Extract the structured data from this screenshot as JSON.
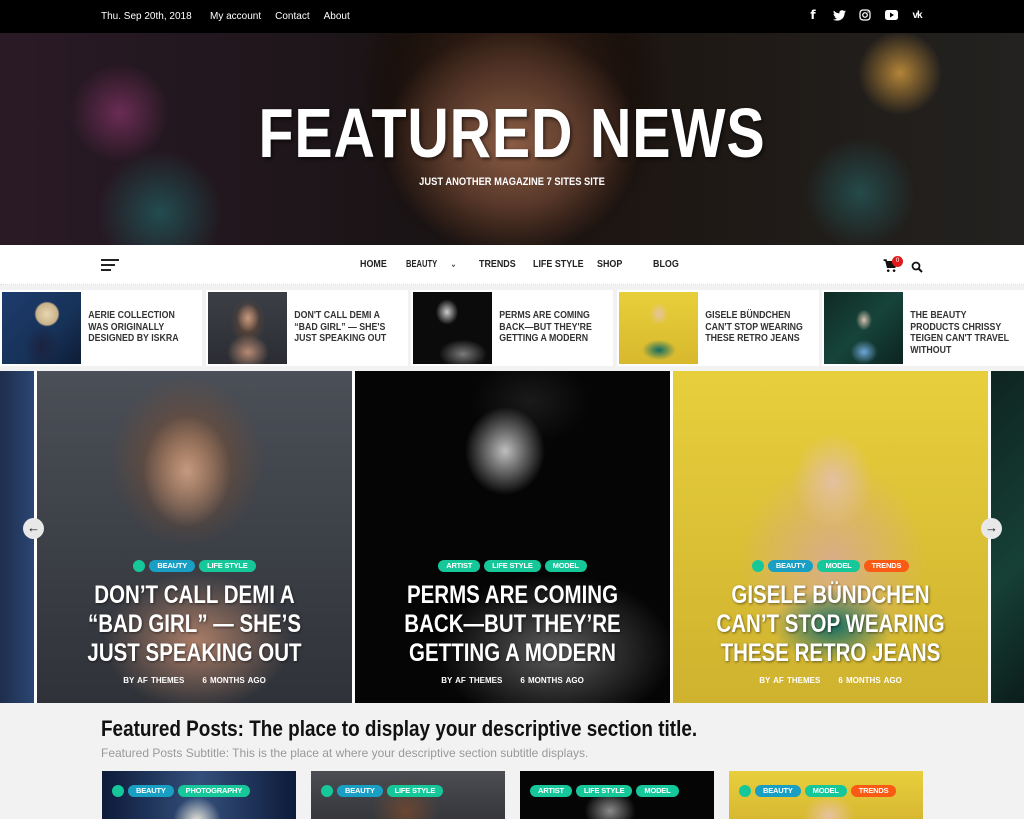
{
  "topbar": {
    "date": "Thu. Sep 20th, 2018",
    "links": [
      "My account",
      "Contact",
      "About"
    ],
    "social": [
      {
        "name": "facebook-icon",
        "glyph": "f"
      },
      {
        "name": "twitter-icon",
        "glyph": "🐦"
      },
      {
        "name": "instagram-icon",
        "glyph": "◎"
      },
      {
        "name": "youtube-icon",
        "glyph": "▶"
      },
      {
        "name": "vk-icon",
        "glyph": "vk"
      }
    ]
  },
  "hero": {
    "site_title": "FEATURED NEWS",
    "tagline": "JUST ANOTHER MAGAZINE 7 SITES SITE"
  },
  "nav": {
    "items": [
      "HOME",
      "BEAUTY",
      "TRENDS",
      "LIFE STYLE",
      "SHOP",
      "BLOG"
    ],
    "dropdown_indicator": "⌄",
    "cart_count": "0"
  },
  "colors": {
    "beauty": "#1a9fc4",
    "life_style": "#16c79a",
    "artist": "#16c79a",
    "model": "#16c79a",
    "photography": "#16c79a",
    "trends": "#fa5a14",
    "cart_badge": "#e01a1a"
  },
  "ticker": [
    {
      "title": "AERIE COLLECTION WAS ORIGINALLY DESIGNED BY ISKRA"
    },
    {
      "title": "DON'T CALL DEMI A “BAD GIRL” — SHE'S JUST SPEAKING OUT"
    },
    {
      "title": "PERMS ARE COMING BACK—BUT THEY'RE GETTING A MODERN"
    },
    {
      "title": "GISELE BÜNDCHEN CAN'T STOP WEARING THESE RETRO JEANS"
    },
    {
      "title": "THE BEAUTY PRODUCTS CHRISSY TEIGEN CAN'T TRAVEL WITHOUT"
    }
  ],
  "slider": {
    "prev_glyph": "←",
    "next_glyph": "→",
    "slides": [
      {
        "categories": [
          "BEAUTY",
          "LIFE STYLE"
        ],
        "title": "DON’T CALL DEMI A “BAD GIRL” — SHE’S JUST SPEAKING OUT",
        "author": "BY AF THEMES",
        "time": "6 MONTHS AGO"
      },
      {
        "categories": [
          "ARTIST",
          "LIFE STYLE",
          "MODEL"
        ],
        "title": "PERMS ARE COMING BACK—BUT THEY’RE GETTING A MODERN",
        "author": "BY AF THEMES",
        "time": "6 MONTHS AGO"
      },
      {
        "categories": [
          "BEAUTY",
          "MODEL",
          "TRENDS"
        ],
        "title": "GISELE BÜNDCHEN CAN’T STOP WEARING THESE RETRO JEANS",
        "author": "BY AF THEMES",
        "time": "6 MONTHS AGO"
      }
    ]
  },
  "featured": {
    "title": "Featured Posts: The place to display your descriptive section title.",
    "subtitle": "Featured Posts Subtitle: This is the place at where your descriptive section subtitle displays.",
    "cards": [
      {
        "categories": [
          "BEAUTY",
          "PHOTOGRAPHY"
        ]
      },
      {
        "categories": [
          "BEAUTY",
          "LIFE STYLE"
        ]
      },
      {
        "categories": [
          "ARTIST",
          "LIFE STYLE",
          "MODEL"
        ]
      },
      {
        "categories": [
          "BEAUTY",
          "MODEL",
          "TRENDS"
        ]
      }
    ]
  }
}
